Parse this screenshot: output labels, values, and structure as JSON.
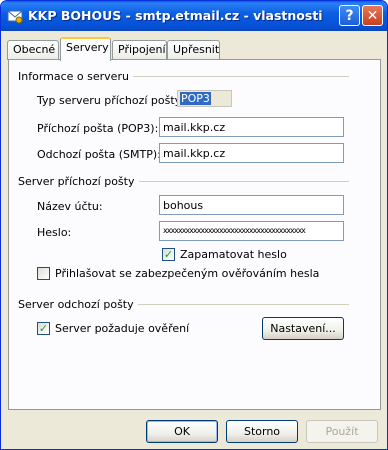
{
  "window": {
    "title": "KKP BOHOUS - smtp.etmail.cz - vlastnosti",
    "help_glyph": "?",
    "close_glyph": "✕"
  },
  "tabs": [
    {
      "label": "Obecné"
    },
    {
      "label": "Servery"
    },
    {
      "label": "Připojení"
    },
    {
      "label": "Upřesnit"
    }
  ],
  "server_info": {
    "group_title": "Informace o serveru",
    "incoming_type_label": "Typ serveru příchozí pošty:",
    "incoming_type_value": "POP3",
    "incoming_label": "Příchozí pošta (POP3):",
    "incoming_value": "mail.kkp.cz",
    "outgoing_label": "Odchozí pošta (SMTP):",
    "outgoing_value": "mail.kkp.cz"
  },
  "incoming_server": {
    "group_title": "Server příchozí pošty",
    "account_label": "Název účtu:",
    "account_value": "bohous",
    "password_label": "Heslo:",
    "password_value": "xxxxxxxxxxxxxxxxxxxxxxxxxxxxxxxxxxxxxx",
    "remember_label": "Zapamatovat heslo",
    "remember_checked": true,
    "spa_label": "Přihlašovat se zabezpečeným ověřováním hesla",
    "spa_checked": false
  },
  "outgoing_server": {
    "group_title": "Server odchozí pošty",
    "auth_label": "Server požaduje ověření",
    "auth_checked": true,
    "settings_button": "Nastavení..."
  },
  "footer": {
    "ok": "OK",
    "cancel": "Storno",
    "apply": "Použít"
  },
  "colors": {
    "titlebar": "#0a5ee6",
    "dialog_bg": "#ece9d8",
    "panel_bg": "#fcfcfe",
    "selection": "#316ac5"
  }
}
